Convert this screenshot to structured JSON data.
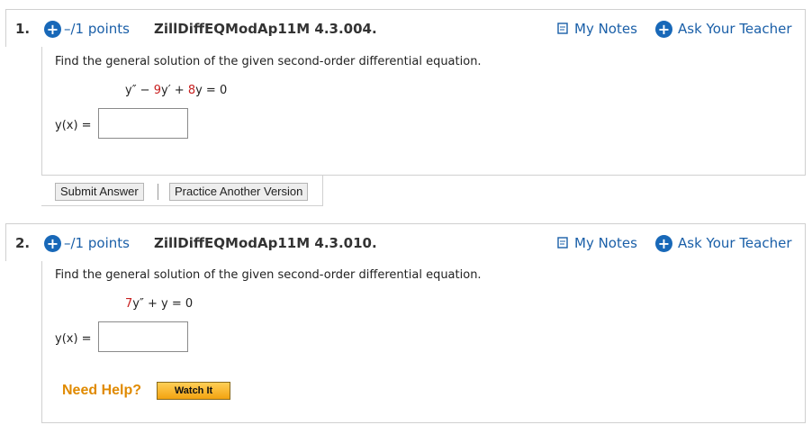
{
  "questions": [
    {
      "number": "1.",
      "points": "–/1 points",
      "title": "ZillDiffEQModAp11M 4.3.004.",
      "my_notes": "My Notes",
      "ask_teacher": "Ask Your Teacher",
      "prompt": "Find the general solution of the given second-order differential equation.",
      "equation": {
        "y2": "y″ − ",
        "c1": "9",
        "y1": "y′ + ",
        "c2": "8",
        "y0": "y = 0"
      },
      "answer_label": "y(x) =",
      "answer_value": "",
      "submit_label": "Submit Answer",
      "practice_label": "Practice Another Version"
    },
    {
      "number": "2.",
      "points": "–/1 points",
      "title": "ZillDiffEQModAp11M 4.3.010.",
      "my_notes": "My Notes",
      "ask_teacher": "Ask Your Teacher",
      "prompt": "Find the general solution of the given second-order differential equation.",
      "equation": {
        "c1": "7",
        "rest": "y″ + y = 0"
      },
      "answer_label": "y(x) =",
      "answer_value": "",
      "need_help": "Need Help?",
      "watch_label": "Watch It"
    }
  ],
  "colors": {
    "link_blue": "#1a5fa8",
    "icon_blue": "#1868b8",
    "coef_red": "#c82020",
    "help_orange": "#e08a00"
  },
  "icons": {
    "expand": "plus-circle-icon",
    "notes": "notepad-icon",
    "ask": "plus-circle-icon"
  }
}
